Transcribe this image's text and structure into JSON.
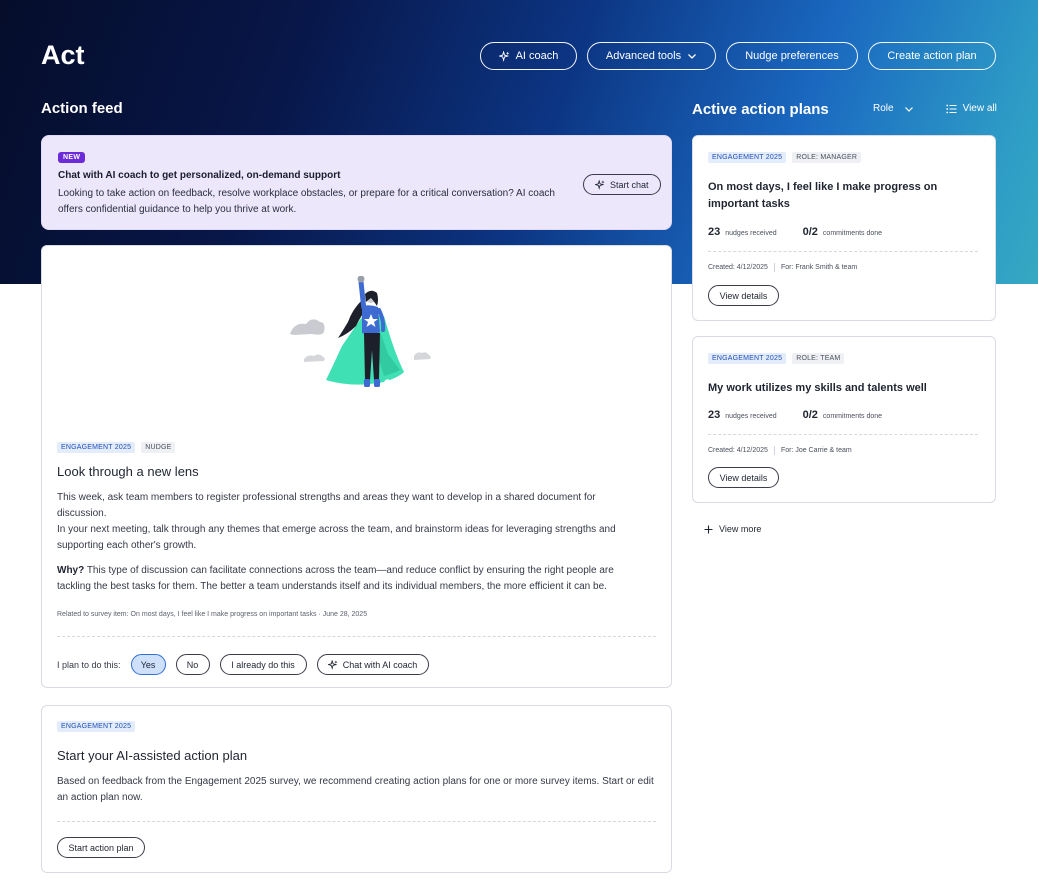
{
  "page": {
    "title": "Act",
    "header_buttons": {
      "ai_coach": "AI coach",
      "advanced_tools": "Advanced tools",
      "nudge_preferences": "Nudge preferences",
      "create_action_plan": "Create action plan"
    }
  },
  "feed": {
    "title": "Action feed",
    "promo": {
      "badge": "NEW",
      "title": "Chat with AI coach to get personalized, on-demand support",
      "description": "Looking to take action on feedback, resolve workplace obstacles, or prepare for a critical conversation? AI coach offers confidential guidance to help you thrive at work.",
      "button": "Start chat"
    },
    "nudge": {
      "tags": [
        "ENGAGEMENT 2025",
        "NUDGE"
      ],
      "title": "Look through a new lens",
      "paragraph1": "This week, ask team members to register professional strengths and areas they want to develop in a shared document for discussion.",
      "paragraph2": "In your next meeting, talk through any themes that emerge across the team, and brainstorm ideas for leveraging strengths and supporting each other's growth.",
      "why_label": "Why?",
      "why_text": " This type of discussion can facilitate connections across the team—and reduce conflict by ensuring the right people are tackling the best tasks for them. The better a team understands itself and its individual members, the more efficient it can be.",
      "related": "Related to survey item: On most days, I feel like I make progress on important tasks  ·  June 28, 2025",
      "plan_prompt": "I plan to do this:",
      "options": [
        "Yes",
        "No",
        "I already do this"
      ],
      "selected_option": "Yes",
      "chat_button": "Chat with AI coach"
    },
    "action_plan": {
      "tag": "ENGAGEMENT 2025",
      "title": "Start your AI-assisted action plan",
      "description": "Based on feedback from the Engagement 2025 survey, we recommend creating action plans for one or more survey items. Start or edit an action plan now.",
      "button": "Start action plan"
    }
  },
  "plans": {
    "title": "Active action plans",
    "role_filter": "Role",
    "view_all": "View all",
    "items": [
      {
        "tags": [
          "ENGAGEMENT 2025",
          "ROLE: MANAGER"
        ],
        "title": "On most days, I feel like I make progress on important tasks",
        "nudges": "23",
        "nudges_label": "nudges received",
        "commitments": "0/2",
        "commitments_label": "commitments done",
        "created": "Created: 4/12/2025",
        "for": "For: Frank Smith & team",
        "button": "View details"
      },
      {
        "tags": [
          "ENGAGEMENT 2025",
          "ROLE: TEAM"
        ],
        "title": "My work utilizes my skills and talents well",
        "nudges": "23",
        "nudges_label": "nudges received",
        "commitments": "0/2",
        "commitments_label": "commitments done",
        "created": "Created: 4/12/2025",
        "for": "For: Joe Carrie & team",
        "button": "View details"
      }
    ],
    "view_more": "View more"
  },
  "colors": {
    "accent_purple": "#6b2bd9",
    "promo_bg": "#ece7fb",
    "tag_blue": "#1f4fb8",
    "selected_option_bg": "#cfe0fb",
    "illustration_cape": "#3ee0b4"
  }
}
